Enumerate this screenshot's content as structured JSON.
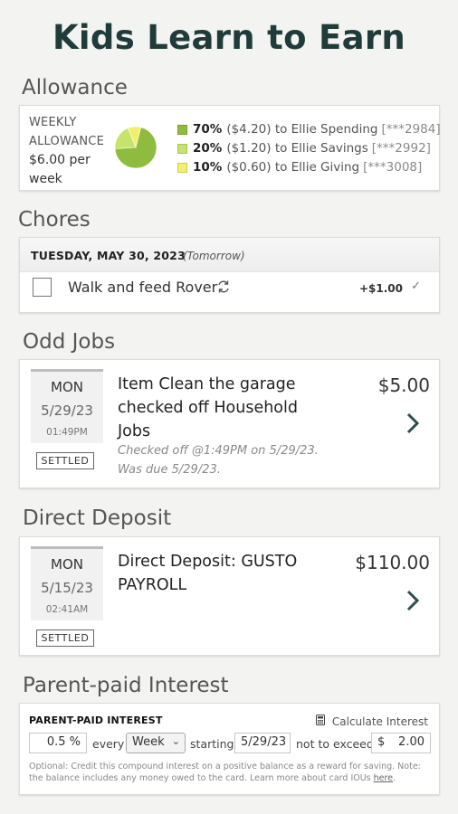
{
  "app": {
    "title": "Kids Learn to Earn"
  },
  "sections": {
    "allowance": "Allowance",
    "chores": "Chores",
    "odd_jobs": "Odd Jobs",
    "direct_deposit": "Direct Deposit",
    "interest": "Parent-paid Interest"
  },
  "allowance": {
    "label_line1": "WEEKLY",
    "label_line2": "ALLOWANCE",
    "amount_line1": "$6.00 per",
    "amount_line2": "week",
    "split": [
      {
        "pct": "70%",
        "amount": "($4.20)",
        "to": "to Ellie Spending",
        "account": "[***2984]",
        "color": "#8fbc3f",
        "fraction": 0.7
      },
      {
        "pct": "20%",
        "amount": "($1.20)",
        "to": "to Ellie Savings",
        "account": "[***2992]",
        "color": "#c6e46b",
        "fraction": 0.2
      },
      {
        "pct": "10%",
        "amount": "($0.60)",
        "to": "to Ellie Giving",
        "account": "[***3008]",
        "color": "#f3ef6e",
        "fraction": 0.1
      }
    ]
  },
  "chores": {
    "date": "TUESDAY, MAY 30, 2023",
    "date_note": "(Tomorrow)",
    "item": {
      "name": "Walk and feed Rover",
      "repeat_icon": "repeat-icon",
      "reward": "+$1.00",
      "check": "✓"
    }
  },
  "odd_jobs": {
    "dow": "MON",
    "date": "5/29/23",
    "time": "01:49PM",
    "badge": "SETTLED",
    "title": "Item Clean the garage checked off Household Jobs",
    "sub_line1": "Checked off @1:49PM on 5/29/23.",
    "sub_line2": "Was due 5/29/23.",
    "amount": "$5.00"
  },
  "direct_deposit": {
    "dow": "MON",
    "date": "5/15/23",
    "time": "02:41AM",
    "badge": "SETTLED",
    "title": "Direct Deposit: GUSTO PAYROLL",
    "amount": "$110.00"
  },
  "interest": {
    "label": "PARENT-PAID INTEREST",
    "calc_link": "Calculate Interest",
    "rate": "0.5 %",
    "every": "every",
    "period": "Week",
    "starting": "starting",
    "start_date": "5/29/23",
    "not_to_exceed": "not to exceed",
    "cap_symbol": "$",
    "cap": "2.00",
    "note": "Optional: Credit this compound interest on a positive balance as a reward for saving. Note: the balance includes any money owed to the card. Learn more about card IOUs",
    "note_link": "here",
    "note_end": "."
  }
}
